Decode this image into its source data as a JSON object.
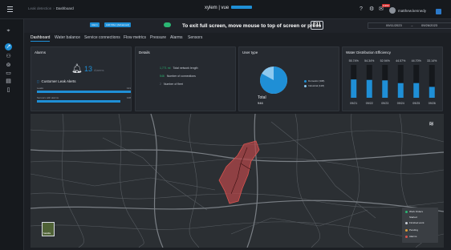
{
  "breadcrumbs": [
    "Leak detection",
    "Dashboard"
  ],
  "brand": "xylem | vue",
  "notification_badge": "9,999",
  "user": {
    "name": "matthew.kennedy"
  },
  "subbar": {
    "chip_1": "Alarm",
    "chip_2": "Add Filter (Advanced)",
    "fullscreen_message": "To exit full screen, move mouse to top of screen or press",
    "fullscreen_key": "F11",
    "date_from": "09/11/2023",
    "arrow": "→",
    "date_to": "09/26/2023"
  },
  "tabs": [
    "Dashboard",
    "Water balance",
    "Service connections",
    "Flow metrics",
    "Pressure",
    "Alarms",
    "Sensors"
  ],
  "alarms_card": {
    "title": "Alarms",
    "count": "13",
    "count_label": "Alarms",
    "customer_alerts": "Customer Leak Alerts",
    "bars": [
      {
        "label": "Leaks",
        "value": "121",
        "fraction": 1.0
      },
      {
        "label": "Sensors with alarms",
        "value": "108",
        "fraction": 0.89
      }
    ]
  },
  "details_card": {
    "title": "Details",
    "metrics": [
      {
        "value": "1,771 mi",
        "label": "Total network length"
      },
      {
        "value": "546",
        "label": "Number of connections"
      },
      {
        "value": "2",
        "label": "Number of fleet"
      }
    ]
  },
  "usertype_card": {
    "title": "User type",
    "legend": [
      {
        "label": "Domestic (308)",
        "color": "#1f8fd6"
      },
      {
        "label": "Industrial (128)",
        "color": "#8ec9ef"
      }
    ],
    "total_label": "Total",
    "total_value": "946",
    "domestic_fraction": 0.83
  },
  "efficiency_card": {
    "title": "Water Distribution Efficiency"
  },
  "chart_data": {
    "type": "bar",
    "title": "Water Distribution Efficiency",
    "categories": [
      "09/21",
      "09/22",
      "09/23",
      "09/24",
      "09/25",
      "09/26"
    ],
    "values": [
      55.74,
      54.34,
      52.94,
      44.57,
      44.7,
      33.14
    ],
    "value_labels": [
      "55.74%",
      "54.34%",
      "52.94%",
      "44.57%",
      "44.70%",
      "33.14%"
    ],
    "ylim": [
      0,
      100
    ],
    "colors": {
      "bar": "#1f8fd6",
      "track": "#15181c"
    }
  },
  "map": {
    "satellite_label": "Satellite",
    "legend": [
      {
        "label": "Work Orders",
        "color": "#2bb673"
      },
      {
        "label": "Started",
        "color": "#3a3e43"
      },
      {
        "label": "Finished work",
        "color": "#c9ced6"
      },
      {
        "label": "Pending",
        "color": "#e0a038"
      },
      {
        "label": "Alarms",
        "color": "#d9534f"
      }
    ]
  }
}
